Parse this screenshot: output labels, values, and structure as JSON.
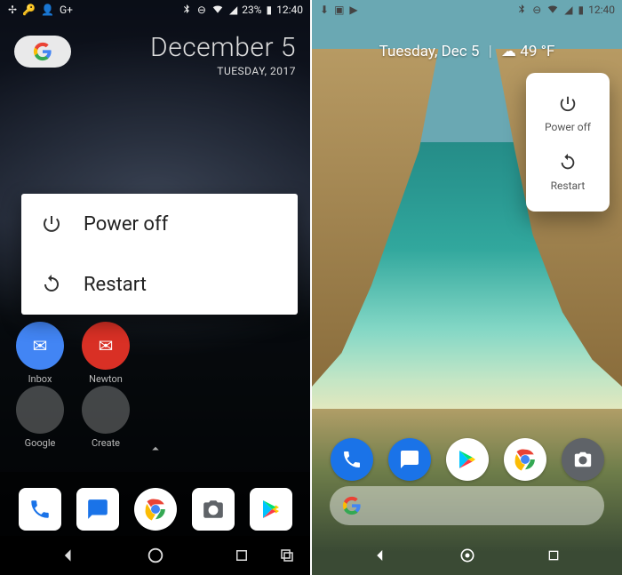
{
  "left": {
    "status": {
      "battery_pct": "23%",
      "time": "12:40"
    },
    "widget": {
      "date_big": "December 5",
      "date_small": "TUESDAY, 2017"
    },
    "power_menu": {
      "power_off": "Power off",
      "restart": "Restart"
    },
    "home_apps": {
      "inbox": "Inbox",
      "newton": "Newton",
      "google": "Google",
      "create": "Create"
    }
  },
  "right": {
    "status": {
      "time": "12:40"
    },
    "smart_line": {
      "date": "Tuesday, Dec 5",
      "sep": "|",
      "weather_temp": "49 °F"
    },
    "power_menu": {
      "power_off": "Power off",
      "restart": "Restart"
    }
  },
  "icons": {
    "power": "power-icon",
    "restart": "restart-icon",
    "cloud": "cloud-icon",
    "google": "google-g-icon"
  },
  "colors": {
    "g_blue": "#4285F4",
    "g_red": "#EA4335",
    "g_yellow": "#FBBC05",
    "g_green": "#34A853",
    "phone_blue": "#1a73e8",
    "camera_grey": "#5f6368"
  }
}
